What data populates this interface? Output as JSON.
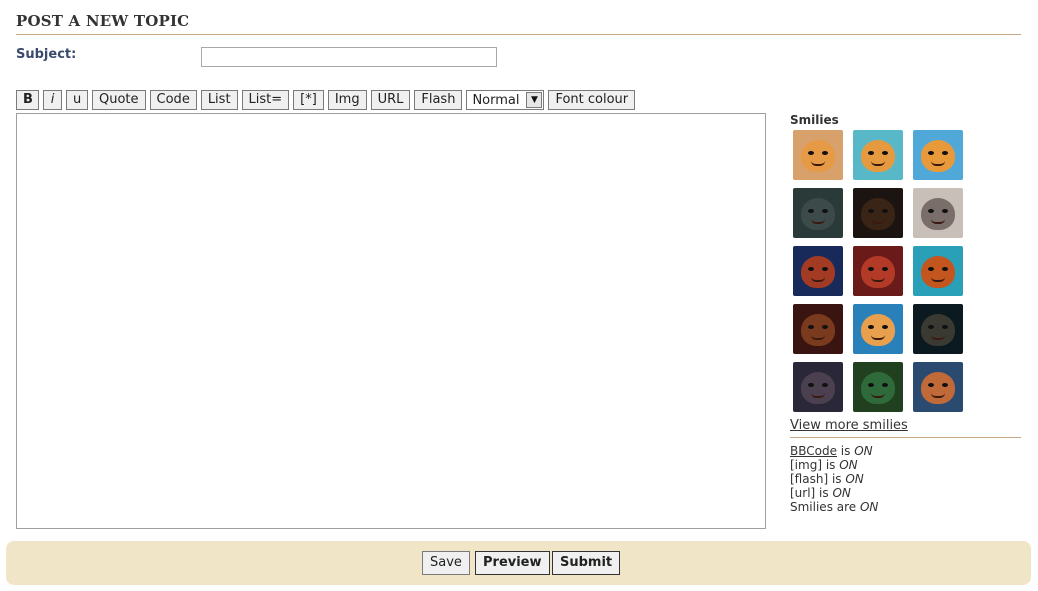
{
  "page": {
    "title": "POST A NEW TOPIC"
  },
  "subject": {
    "label": "Subject:",
    "value": ""
  },
  "toolbar": {
    "bold": "B",
    "italic": "i",
    "underline": "u",
    "quote": "Quote",
    "code": "Code",
    "list": "List",
    "list_ordered": "List=",
    "list_item": "[*]",
    "img": "Img",
    "url": "URL",
    "flash": "Flash",
    "font_size_selected": "Normal",
    "font_colour": "Font colour"
  },
  "editor": {
    "value": ""
  },
  "smilies": {
    "title": "Smilies",
    "icons": [
      "lion-cub-smile-icon",
      "lion-cub-grin-icon",
      "lion-cub-happy-icon",
      "lion-frown-icon",
      "lion-scowl-icon",
      "baboon-icon",
      "lion-wink-icon",
      "lion-laugh-icon",
      "lion-cheer-icon",
      "lion-angry-icon",
      "lioness-cub-icon",
      "lion-dark-icon",
      "lion-shadow-icon",
      "lion-green-icon",
      "lion-sad-icon"
    ],
    "colors": [
      "#e79a45",
      "#e69a3f",
      "#e89a3a",
      "#3d4a4a",
      "#3a2416",
      "#7a6e6a",
      "#a23a24",
      "#b23a26",
      "#c2561e",
      "#7a3a1e",
      "#e9a04e",
      "#3a3a32",
      "#4a4050",
      "#2f6a3a",
      "#c06a3a"
    ],
    "backgrounds": [
      "#d8a06a",
      "#58b8c8",
      "#50a8d8",
      "#2a3a38",
      "#1c1410",
      "#c8c0b8",
      "#182a5a",
      "#6a1a18",
      "#2aa0b8",
      "#3a1410",
      "#2a80b8",
      "#0a1a20",
      "#2a2838",
      "#204020",
      "#2a4a70"
    ],
    "more_link": "View more smilies"
  },
  "bbcode_info": {
    "bbcode_link": "BBCode",
    "bbcode_is": " is ",
    "bbcode_state": "ON",
    "img_label": "[img] is ",
    "img_state": "ON",
    "flash_label": "[flash] is ",
    "flash_state": "ON",
    "url_label": "[url] is ",
    "url_state": "ON",
    "smilies_label": "Smilies are ",
    "smilies_state": "ON"
  },
  "actions": {
    "save": "Save",
    "preview": "Preview",
    "submit": "Submit"
  }
}
